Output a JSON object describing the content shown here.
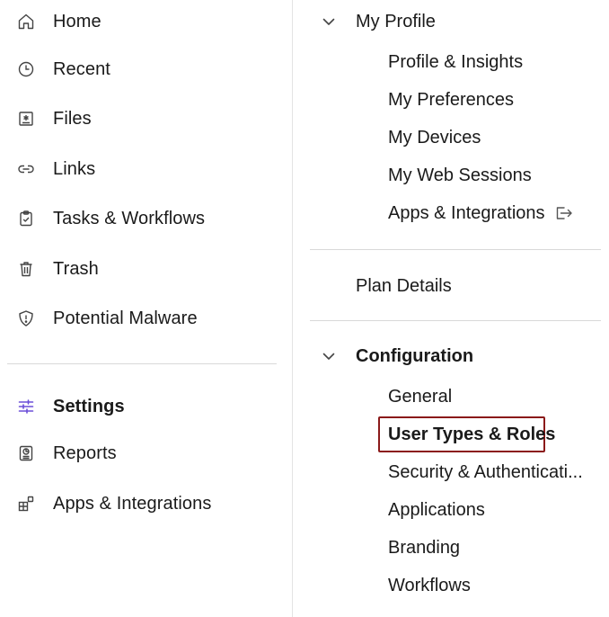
{
  "sidebar": {
    "items": [
      {
        "label": "Home",
        "icon": "home-icon"
      },
      {
        "label": "Recent",
        "icon": "clock-icon"
      },
      {
        "label": "Files",
        "icon": "files-icon"
      },
      {
        "label": "Links",
        "icon": "link-icon"
      },
      {
        "label": "Tasks & Workflows",
        "icon": "clipboard-check-icon"
      },
      {
        "label": "Trash",
        "icon": "trash-icon"
      },
      {
        "label": "Potential Malware",
        "icon": "shield-alert-icon"
      },
      {
        "label": "Settings",
        "icon": "sliders-icon",
        "active": true
      },
      {
        "label": "Reports",
        "icon": "report-icon"
      },
      {
        "label": "Apps & Integrations",
        "icon": "apps-grid-icon"
      }
    ],
    "accent_color": "#6b4fd8"
  },
  "settings_menu": {
    "my_profile": {
      "label": "My Profile",
      "items": [
        {
          "label": "Profile & Insights"
        },
        {
          "label": "My Preferences"
        },
        {
          "label": "My Devices"
        },
        {
          "label": "My Web Sessions"
        },
        {
          "label": "Apps & Integrations",
          "external": true
        }
      ]
    },
    "plan_details": {
      "label": "Plan Details"
    },
    "configuration": {
      "label": "Configuration",
      "items": [
        {
          "label": "General"
        },
        {
          "label": "User Types & Roles",
          "selected": true
        },
        {
          "label": "Security & Authenticati..."
        },
        {
          "label": "Applications"
        },
        {
          "label": "Branding"
        },
        {
          "label": "Workflows"
        }
      ]
    },
    "highlight_color": "#8b1a1a"
  }
}
